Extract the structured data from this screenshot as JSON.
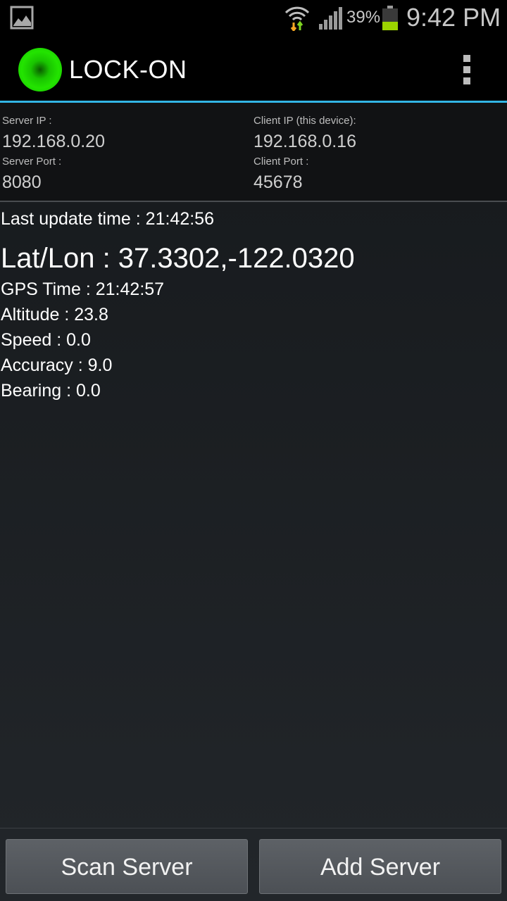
{
  "status_bar": {
    "left_icon": "image-icon",
    "wifi_icon": "wifi-icon",
    "signal_icon": "signal-icon",
    "battery_percent": "39%",
    "battery_icon": "battery-icon",
    "battery_level": 0.39,
    "time": "9:42 PM",
    "colors": {
      "battery_fill": "#9cd400",
      "wifi_up": "#7ed321",
      "wifi_down": "#f5a623"
    }
  },
  "header": {
    "title": "LOCK-ON",
    "logo_icon": "green-status-light-icon",
    "menu_icon": "overflow-menu-icon",
    "accent_color": "#33b5e5"
  },
  "connection": {
    "server_ip_label": "Server IP :",
    "server_ip": "192.168.0.20",
    "server_port_label": "Server Port :",
    "server_port": "8080",
    "client_ip_label": "Client IP (this device):",
    "client_ip": "192.168.0.16",
    "client_port_label": "Client Port :",
    "client_port": "45678"
  },
  "gps": {
    "last_update": "Last update time : 21:42:56",
    "lat_lon": "Lat/Lon : 37.3302,-122.0320",
    "gps_time": "GPS Time : 21:42:57",
    "altitude": "Altitude : 23.8",
    "speed": "Speed : 0.0",
    "accuracy": "Accuracy : 9.0",
    "bearing": "Bearing : 0.0"
  },
  "buttons": {
    "scan_label": "Scan Server",
    "add_label": "Add Server"
  }
}
